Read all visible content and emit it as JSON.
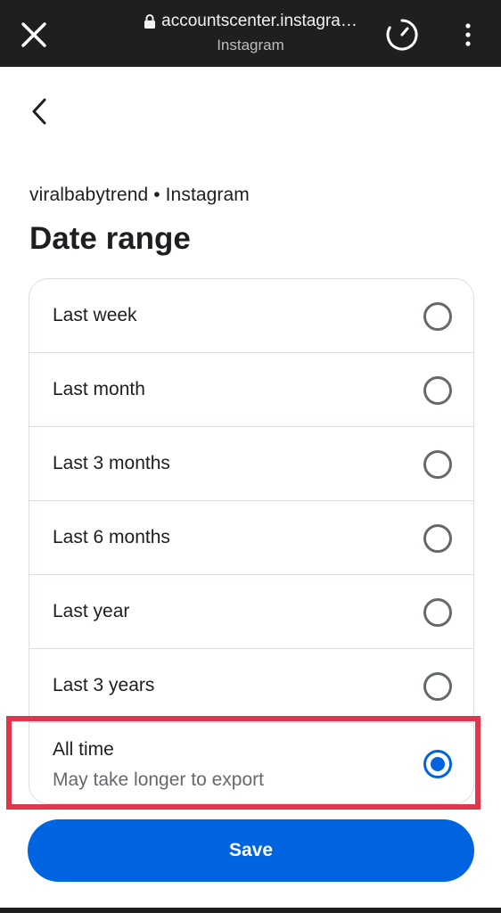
{
  "browser": {
    "url": "accountscenter.instagra…",
    "site_name": "Instagram",
    "icons": [
      "close-icon",
      "lock-icon",
      "loading-icon",
      "more-vert-icon"
    ]
  },
  "page": {
    "subtitle": "viralbabytrend • Instagram",
    "title": "Date range"
  },
  "options": [
    {
      "label": "Last week",
      "selected": false
    },
    {
      "label": "Last month",
      "selected": false
    },
    {
      "label": "Last 3 months",
      "selected": false
    },
    {
      "label": "Last 6 months",
      "selected": false
    },
    {
      "label": "Last year",
      "selected": false
    },
    {
      "label": "Last 3 years",
      "selected": false
    },
    {
      "label": "All time",
      "sublabel": "May take longer to export",
      "selected": true
    }
  ],
  "actions": {
    "save_label": "Save"
  },
  "colors": {
    "accent": "#0064e0",
    "highlight": "#e0354d",
    "topbar": "#1f1f1f"
  }
}
